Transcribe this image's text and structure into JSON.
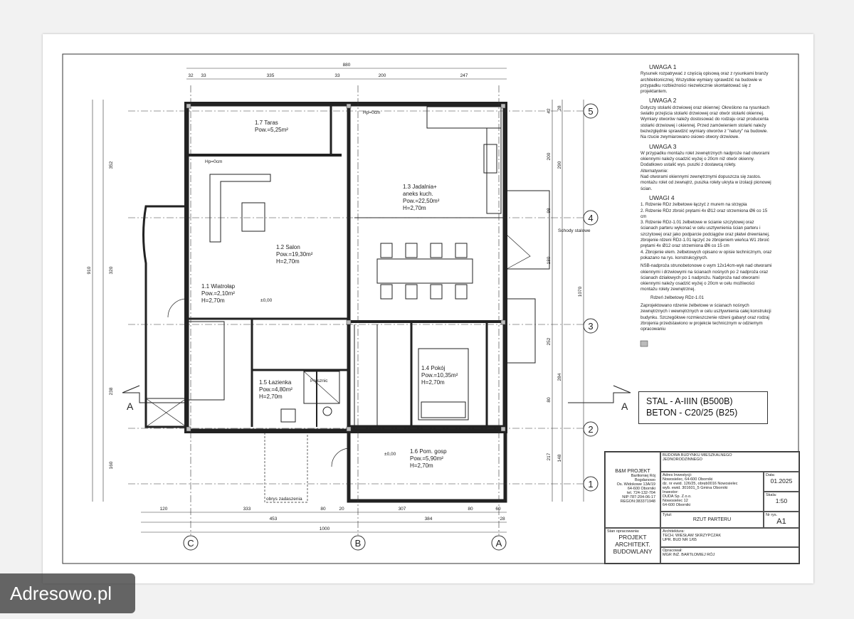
{
  "notes": {
    "h1": "UWAGA 1",
    "p1": "Rysunek rozpatrywać z częścią opisową oraz z rysunkami branży architektonicznej. Wszystkie wymiary sprawdzić na budowie w przypadku rozbieżności niezwłocznie skontaktować się z projektantem.",
    "h2": "UWAGA 2",
    "p2": "Dotyczy stolarki drzwiowej oraz okiennej: Określono na rysunkach światło przejścia stolarki drzwiowej oraz otwór stolarki okiennej. Wymiary otworów należy dostosować do rodzaju oraz producenta stolarki drzwiowej i okiennej. Przed zamówieniem stolarki należy bezwzględnie sprawdzić wymiary otworów z \"natury\" na budowie. Na rzucie zwymiarowano osiowo otwory drzwiowe.",
    "h3": "UWAGA 3",
    "p3": "W przypadku montażu rolet zewnętrznych nadproże nad otworami okiennymi należy osadzić wyżej o 20cm niż otwór okienny. Dodatkowo ustalić wys. puszki z dostawcą rolety.\nAlternatywnie:\nNad otworami okiennymi zewnętrznymi dopuszcza się zastos. montażu rolet od zewnątrz, puszka rolety ukryta w izolacji pionowej ścian.",
    "h4": "UWAGI 4",
    "p4": "1. Rdzenie RDz żelbetowe łączyć z murem na strzępia\n2. Rdzenie RDz zbroić prętami 4x Ø12 oraz strzemiona Ø6 co 15 cm\n3. Rdzenie RDz-1.01 żelbetowe w ścianie szczytowej oraz ścianach parteru wykonać w celu usztywnienia ścian parteru i szczytowej oraz jako podparcie podciągów oraz płatwi drewnianej, zbrojenie rdzeni RDz-1.01 łączyć ze zbrojeniem wieńca W1 zbroić prętami 4x Ø12 oraz strzemiona Ø6 co 15 cm\n4. Zbrojenie elem. żelbetowych opisano w opisie technicznym, oraz pokazano na rys. konstrukcyjnych.",
    "p5": "NSB-nadproża strunobetonowe o wym 12x14cm-wyk nad otworami okiennymi i drzwiowymi na ścianach nośnych po 2 nadproża oraz ścianach działowych po 1 nadprożu. Nadproża nad otworami okiennymi należy osadzić wyżej o 20cm w celu możliwości montażu rolety zewnętrznej.",
    "legend": "Rdzeń żelbetowy RDz-1.01",
    "p6": "Zaprojektowano rdzenie żelbetowe w ścianach nośnych zewnętrznych i wewnętrznych w celu usztywnienia całej konstrukcji budynku. Szczegółowe rozmieszczenie rdzeni gabaryt oraz rodzaj zbrojenia przedstawiono w projekcie technicznym w odziemym opracowaniu"
  },
  "spec": {
    "steel": "STAL - A-IIIN (B500B)",
    "concrete": "BETON - C20/25 (B25)"
  },
  "rooms": {
    "taras": {
      "name": "1.7 Taras",
      "area": "Pow.=5,25m²"
    },
    "salon": {
      "name": "1.2 Salon",
      "area": "Pow.=19,30m²",
      "h": "H=2,70m"
    },
    "jadalnia": {
      "name1": "1.3 Jadalnia+",
      "name2": "aneks kuch.",
      "area": "Pow.=22,50m²",
      "h": "H=2,70m"
    },
    "wiatrolap": {
      "name": "1.1 Wiatrołap",
      "area": "Pow.=2,10m²",
      "h": "H=2,70m"
    },
    "pokoj": {
      "name": "1.4 Pokój",
      "area": "Pow.=10,35m²",
      "h": "H=2,70m"
    },
    "lazienka": {
      "name": "1.5 Łazienka",
      "area": "Pow.=4,80m²",
      "h": "H=2,70m"
    },
    "gosp": {
      "name": "1.6 Pom. gosp",
      "area": "Pow.=5,90m²",
      "h": "H=2,70m"
    }
  },
  "labels": {
    "schody": "Schody stalowe",
    "obrys": "obrys zadaszenia",
    "prysznic": "Prysznic",
    "hp0": "Hp=0cm",
    "hp60": "Hp=60cm",
    "zero": "±0,00",
    "section": "A"
  },
  "grid": {
    "rows": [
      "5",
      "4",
      "3",
      "2",
      "1"
    ],
    "cols": [
      "C",
      "B",
      "A"
    ]
  },
  "dims": {
    "top1": [
      "32",
      "33",
      "335",
      "33",
      "200",
      "247"
    ],
    "top_total": "880",
    "bottom1": [
      "120",
      "333",
      "80",
      "20",
      "307",
      "80",
      "60"
    ],
    "bottom2": [
      "453",
      "384",
      "28"
    ],
    "bottom_total": "1000",
    "left": [
      "352",
      "320",
      "238",
      "160"
    ],
    "left_total": "910",
    "right": [
      "200",
      "290",
      "252",
      "284",
      "148"
    ],
    "right2": [
      "28",
      "42",
      "98",
      "180",
      "80",
      "217"
    ],
    "right_total": "1070"
  },
  "title_block": {
    "firm": "B&M PROJEKT",
    "firm_addr": "Bartłomiej Rój\nBogdanowo\nOs. Widokowe 13A/19\n64-600 Oborniki\ntel. 724-132-704\nNIP:787-204-06-17\nREGON:383371948",
    "building": "BUDOWA BUDYNKU MIESZKALNEGO\nJEDNORODZINNEGO",
    "addr_label": "Adres Inwestycji:",
    "addr": "Nowosielec, 64-600 Oborniki\ndz. nr ewid. 126/25, obręb0016 Nowosielec\nwyb. ewid. 301601_5 Gmina Oborniki",
    "inv_label": "Inwestor:",
    "inv": "DUDA Sp. Z.o.o.\nNowosielec 12\n64-600 Oborniki",
    "date_label": "Data:",
    "date": "01.2025",
    "scale_label": "Skala:",
    "scale": "1:50",
    "title_label": "Tytuł:",
    "title": "RZUT PARTERU",
    "no_label": "Nr rys.",
    "no": "A1",
    "stage_label": "Stan opracowania:",
    "stage": "PROJEKT\nARCHITEKT.\nBUDOWLANY",
    "arch_label": "Architektura:",
    "arch": "TECH. WIESŁAW SKRZYPCZAK\nUPR. BUD NR 1/65",
    "op_label": "Opracował:",
    "op": "MGR INŻ. BARTŁOMIEJ RÓJ"
  },
  "watermark": "Adresowo.pl"
}
